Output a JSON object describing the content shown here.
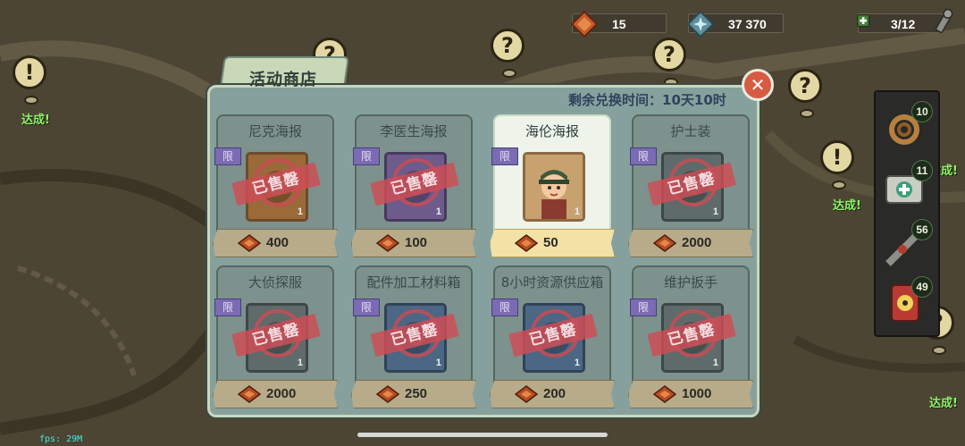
{
  "resources": {
    "caps": "15",
    "quantum": "37 370",
    "dwellers": "3/12",
    "caps_color": "#c75a2b",
    "quantum_color": "#7fb7c9"
  },
  "shop": {
    "title": "活动商店",
    "time_label": "剩余兑换时间：",
    "time_value": "10天10时",
    "close_icon": "close-icon",
    "items": [
      {
        "name": "尼克海报",
        "limit": "限",
        "qty": "1",
        "price": "400",
        "status": "sold",
        "stamp": "已售罄",
        "frame": "f-orange"
      },
      {
        "name": "李医生海报",
        "limit": "限",
        "qty": "1",
        "price": "100",
        "status": "sold",
        "stamp": "已售罄",
        "frame": "f-purple"
      },
      {
        "name": "海伦海报",
        "limit": "限",
        "qty": "1",
        "price": "50",
        "status": "available",
        "stamp": "",
        "frame": "f-helen"
      },
      {
        "name": "护士装",
        "limit": "限",
        "qty": "1",
        "price": "2000",
        "status": "sold",
        "stamp": "已售罄",
        "frame": "f-gray"
      },
      {
        "name": "大侦探服",
        "limit": "限",
        "qty": "1",
        "price": "2000",
        "status": "sold",
        "stamp": "已售罄",
        "frame": "f-gray"
      },
      {
        "name": "配件加工材料箱",
        "limit": "限",
        "qty": "1",
        "price": "250",
        "status": "sold",
        "stamp": "已售罄",
        "frame": "f-blue"
      },
      {
        "name": "8小时资源供应箱",
        "limit": "限",
        "qty": "1",
        "price": "200",
        "status": "sold",
        "stamp": "已售罄",
        "frame": "f-blue"
      },
      {
        "name": "维护扳手",
        "limit": "限",
        "qty": "1",
        "price": "1000",
        "status": "sold",
        "stamp": "已售罄",
        "frame": "f-gray"
      }
    ]
  },
  "side_panel": [
    {
      "icon": "rope-icon",
      "count": "10"
    },
    {
      "icon": "first-aid-kit-icon",
      "count": "11"
    },
    {
      "icon": "stimpak-icon",
      "count": "56"
    },
    {
      "icon": "radaway-icon",
      "count": "49"
    }
  ],
  "map": {
    "achieved_labels": [
      "达成!",
      "达成!",
      "达成!",
      "达成!"
    ]
  },
  "fps": "fps: 29M"
}
